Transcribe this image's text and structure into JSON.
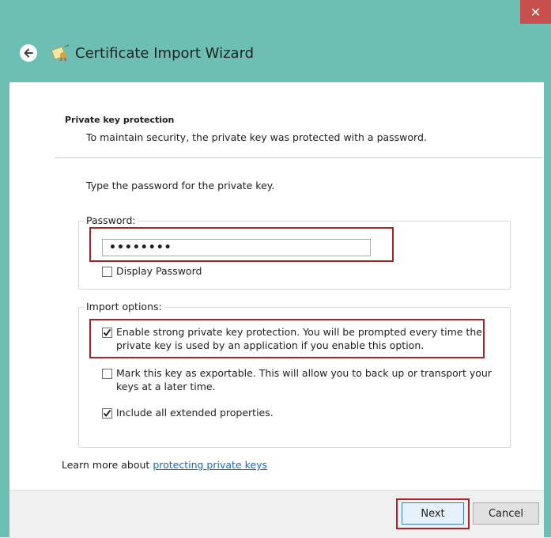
{
  "window": {
    "title": "Certificate Import Wizard",
    "close_glyph": "✕"
  },
  "header": {
    "section_title": "Private key protection",
    "section_subtitle": "To maintain security, the private key was protected with a password."
  },
  "main": {
    "prompt": "Type the password for the private key.",
    "password_group_label": "Password:",
    "password_value": "••••••••",
    "display_password_label": "Display Password",
    "display_password_checked": false,
    "import_options_label": "Import options:",
    "options": [
      {
        "line1": "Enable strong private key protection. You will be prompted every time the",
        "line2": "private key is used by an application if you enable this option.",
        "checked": true
      },
      {
        "line1": "Mark this key as exportable. This will allow you to back up or transport your",
        "line2": "keys at a later time.",
        "checked": false
      },
      {
        "line1": "Include all extended properties.",
        "checked": true
      }
    ],
    "learn_more_text": "Learn more about",
    "learn_more_link": "protecting private keys"
  },
  "footer": {
    "next_label": "Next",
    "cancel_label": "Cancel"
  },
  "colors": {
    "titlebar": "#6cbfb2",
    "close": "#c7504f",
    "highlight": "#a5242b",
    "link": "#0e6bc7"
  }
}
